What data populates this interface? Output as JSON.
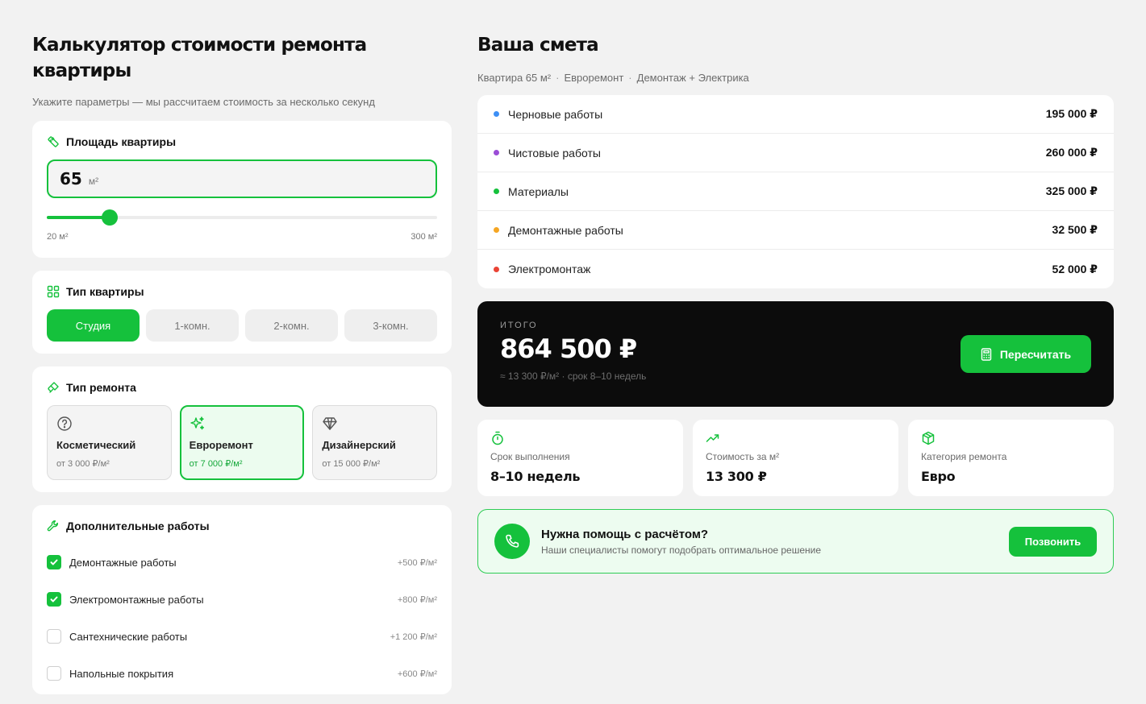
{
  "calculator": {
    "title": "Калькулятор стоимости ремонта квартиры",
    "subtitle": "Укажите параметры — мы рассчитаем стоимость за несколько секунд",
    "area": {
      "heading": "Площадь квартиры",
      "value": "65",
      "unit": "м²",
      "min_label": "20 м²",
      "max_label": "300 м²",
      "min": 20,
      "max": 300,
      "current": 65
    },
    "apartment_type": {
      "heading": "Тип квартиры",
      "options": [
        "Студия",
        "1-комн.",
        "2-комн.",
        "3-комн."
      ],
      "selected": "Студия"
    },
    "repair_type": {
      "heading": "Тип ремонта",
      "options": [
        {
          "name": "Косметический",
          "price": "от 3 000 ₽/м²",
          "icon": "question-circle-icon"
        },
        {
          "name": "Евроремонт",
          "price": "от 7 000 ₽/м²",
          "icon": "sparkles-icon"
        },
        {
          "name": "Дизайнерский",
          "price": "от 15 000 ₽/м²",
          "icon": "diamond-icon"
        }
      ],
      "selected": "Евроремонт"
    },
    "extras": {
      "heading": "Дополнительные работы",
      "items": [
        {
          "label": "Демонтажные работы",
          "price": "+500 ₽/м²",
          "checked": true
        },
        {
          "label": "Электромонтажные работы",
          "price": "+800 ₽/м²",
          "checked": true
        },
        {
          "label": "Сантехнические работы",
          "price": "+1 200 ₽/м²",
          "checked": false
        },
        {
          "label": "Напольные покрытия",
          "price": "+600 ₽/м²",
          "checked": false
        }
      ]
    }
  },
  "estimate": {
    "title": "Ваша смета",
    "meta": [
      "Квартира 65 м²",
      "Евроремонт",
      "Демонтаж + Электрика"
    ],
    "rows": [
      {
        "name": "Черновые работы",
        "amount": "195 000 ₽",
        "color": "#3d8ff5"
      },
      {
        "name": "Чистовые работы",
        "amount": "260 000 ₽",
        "color": "#9b4dd6"
      },
      {
        "name": "Материалы",
        "amount": "325 000 ₽",
        "color": "#15c13c"
      },
      {
        "name": "Демонтажные работы",
        "amount": "32 500 ₽",
        "color": "#f5a623"
      },
      {
        "name": "Электромонтаж",
        "amount": "52 000 ₽",
        "color": "#ea4335"
      }
    ],
    "total": {
      "label": "итого",
      "sum": "864 500 ₽",
      "sub": "≈ 13 300 ₽/м² · срок 8–10 недель",
      "button": "Пересчитать"
    },
    "stats": [
      {
        "label": "Срок выполнения",
        "value": "8–10 недель",
        "icon": "stopwatch-icon"
      },
      {
        "label": "Стоимость за м²",
        "value": "13 300 ₽",
        "icon": "trend-up-icon"
      },
      {
        "label": "Категория ремонта",
        "value": "Евро",
        "icon": "box-icon"
      }
    ],
    "help": {
      "title": "Нужна помощь с расчётом?",
      "subtitle": "Наши специалисты помогут подобрать оптимальное решение",
      "button": "Позвонить"
    }
  },
  "colors": {
    "accent": "#15c13c",
    "dark": "#0c0c0c",
    "background": "#f2f2f2"
  }
}
